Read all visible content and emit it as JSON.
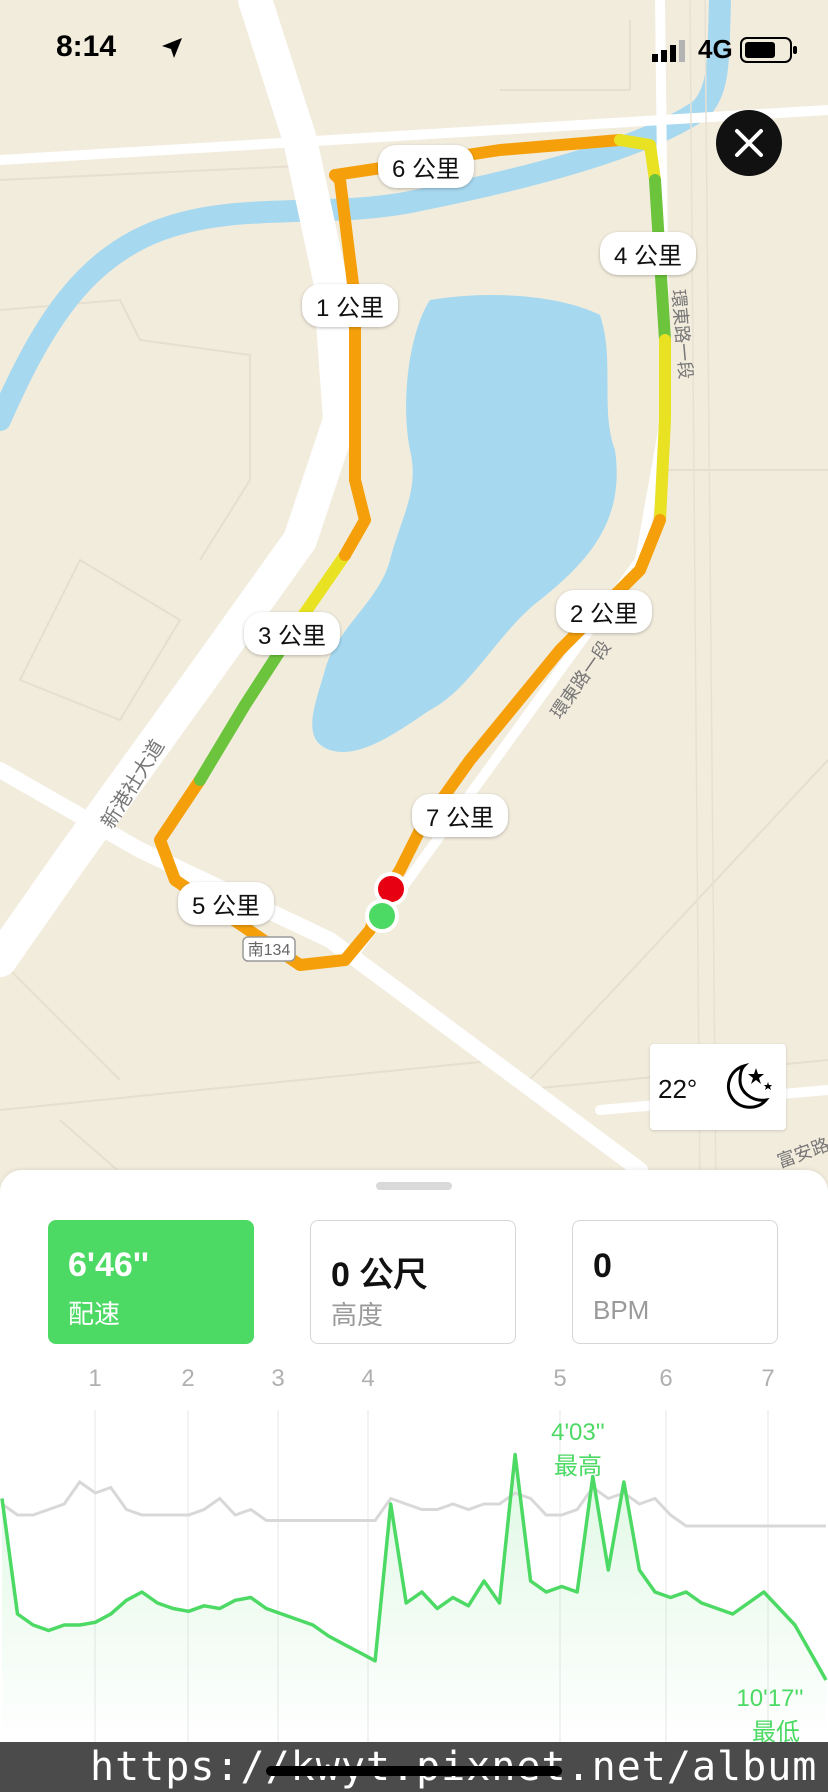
{
  "status_bar": {
    "time": "8:14",
    "network": "4G"
  },
  "map": {
    "km_markers": [
      "1 公里",
      "2 公里",
      "3 公里",
      "4 公里",
      "5 公里",
      "6 公里",
      "7 公里"
    ],
    "road_labels": {
      "avenue": "新港社大道",
      "east_road_upper": "環東路一段",
      "east_road_lower": "環東路一段",
      "route": "南134",
      "fuan": "富安路"
    },
    "colors": {
      "water": "#a6d8ef",
      "land": "#f2ecdd",
      "road": "#ffffff",
      "route_orange": "#f5a00b",
      "route_yellow": "#e8e222",
      "route_green": "#6cc43c",
      "start": "#4cd964",
      "end": "#e60012"
    }
  },
  "weather": {
    "temperature": "22°",
    "icon": "moon-stars-icon"
  },
  "close_icon": "close-icon",
  "metrics": {
    "pace": {
      "value": "6'46''",
      "label": "配速"
    },
    "altitude": {
      "value": "0 公尺",
      "label": "高度"
    },
    "heart_rate": {
      "value": "0",
      "label": "BPM"
    }
  },
  "chart_data": {
    "type": "line",
    "km_ticks": [
      "1",
      "2",
      "3",
      "4",
      "5",
      "6",
      "7"
    ],
    "series": [
      {
        "color": "#4cd964",
        "values": [
          3.3,
          1.2,
          1.0,
          0.9,
          1.0,
          1.0,
          1.05,
          1.2,
          1.45,
          1.6,
          1.4,
          1.3,
          1.25,
          1.35,
          1.3,
          1.45,
          1.5,
          1.3,
          1.2,
          1.1,
          1.0,
          0.8,
          0.65,
          0.5,
          0.35,
          3.2,
          1.4,
          1.6,
          1.3,
          1.5,
          1.35,
          1.8,
          1.4,
          4.1,
          1.8,
          1.6,
          1.7,
          1.6,
          3.7,
          2.0,
          3.6,
          2.0,
          1.6,
          1.5,
          1.6,
          1.4,
          1.3,
          1.2,
          1.4,
          1.6,
          1.3,
          1.0,
          0.5,
          0.0
        ]
      },
      {
        "color": "#d8d8d8",
        "values": [
          3.2,
          3.0,
          3.0,
          3.1,
          3.2,
          3.6,
          3.4,
          3.5,
          3.1,
          3.0,
          3.0,
          3.0,
          3.0,
          3.1,
          3.3,
          3.0,
          3.1,
          2.9,
          2.9,
          2.9,
          2.9,
          2.9,
          2.9,
          2.9,
          2.9,
          3.3,
          3.2,
          3.1,
          3.1,
          3.2,
          3.1,
          3.2,
          3.2,
          3.4,
          3.3,
          3.0,
          3.0,
          3.1,
          3.5,
          3.3,
          3.4,
          3.2,
          3.3,
          3.0,
          2.8,
          2.8,
          2.8,
          2.8,
          2.8,
          2.8,
          2.8,
          2.8,
          2.8,
          2.8
        ]
      }
    ],
    "max_label": {
      "value": "4'03''",
      "text": "最高"
    },
    "min_label": {
      "value": "10'17''",
      "text": "最低"
    }
  },
  "watermark": "https://kwyt.pixnet.net/album"
}
